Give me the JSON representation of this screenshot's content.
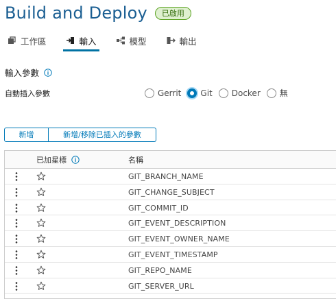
{
  "header": {
    "title": "Build and Deploy",
    "status_badge": "已啟用"
  },
  "tabs": [
    {
      "label": "工作區",
      "icon": "workspace-icon",
      "active": false
    },
    {
      "label": "輸入",
      "icon": "input-icon",
      "active": true
    },
    {
      "label": "模型",
      "icon": "model-icon",
      "active": false
    },
    {
      "label": "輸出",
      "icon": "output-icon",
      "active": false
    }
  ],
  "section": {
    "title": "輸入參數",
    "info_icon": "info-icon"
  },
  "auto_inject": {
    "label": "自動插入參數",
    "options": [
      "Gerrit",
      "Git",
      "Docker",
      "無"
    ],
    "selected": "Git"
  },
  "buttons": {
    "add": "新增",
    "add_remove": "新增/移除已插入的參數"
  },
  "grid": {
    "columns": {
      "starred": "已加星標",
      "name": "名稱"
    },
    "rows": [
      "GIT_BRANCH_NAME",
      "GIT_CHANGE_SUBJECT",
      "GIT_COMMIT_ID",
      "GIT_EVENT_DESCRIPTION",
      "GIT_EVENT_OWNER_NAME",
      "GIT_EVENT_TIMESTAMP",
      "GIT_REPO_NAME",
      "GIT_SERVER_URL"
    ]
  },
  "colors": {
    "title": "#1a5e92",
    "accent": "#0079b8",
    "badge_border": "#5aa220",
    "badge_bg": "#dff0d0"
  }
}
